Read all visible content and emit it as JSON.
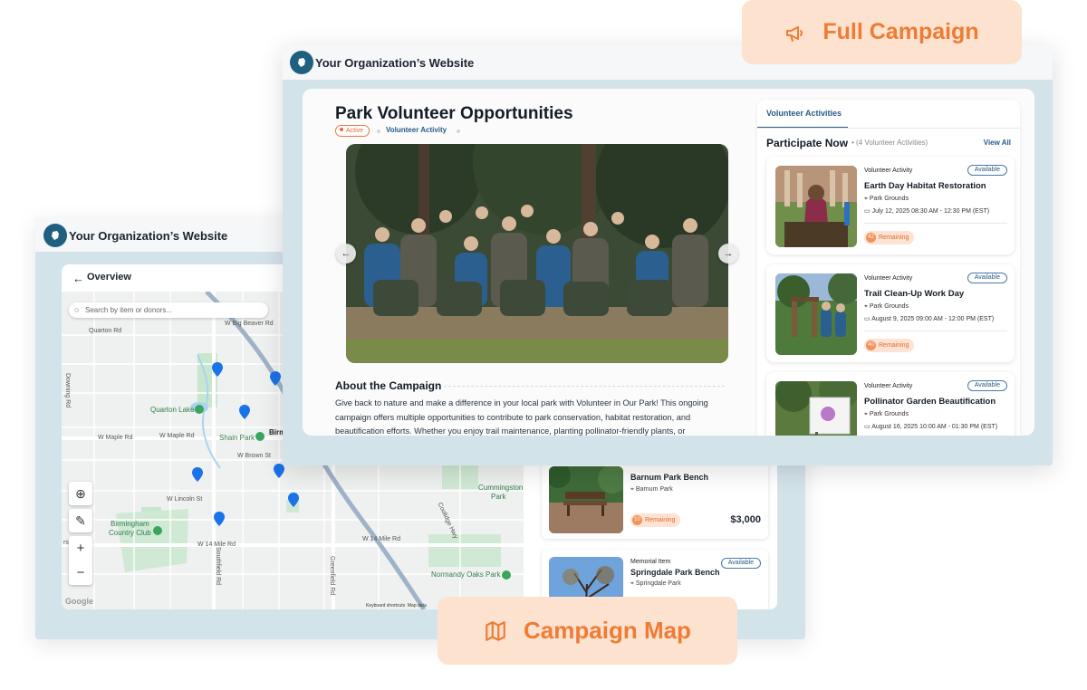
{
  "site_title": "Your Organization’s Website",
  "full_campaign_label": "Full Campaign",
  "campaign_map_label": "Campaign Map",
  "campaign": {
    "title": "Park Volunteer Opportunities",
    "status": "Active",
    "type": "Volunteer Activity",
    "about_title": "About the Campaign",
    "about_text": "Give back to nature and make a difference in your local park with Volunteer in Our Park! This ongoing campaign offers multiple opportunities to contribute to park conservation, habitat restoration, and beautification efforts. Whether you enjoy trail maintenance, planting pollinator-friendly plants, or"
  },
  "activities": {
    "tab": "Volunteer Activities",
    "heading": "Participate Now",
    "count": "(4 Volunteer Activities)",
    "view_all": "View All",
    "items": [
      {
        "type": "Volunteer Activity",
        "status": "Available",
        "title": "Earth Day Habitat Restoration",
        "location": "Park Grounds",
        "date": "July 12, 2025 08:30 AM - 12:30 PM (EST)",
        "remaining_count": "42",
        "remaining_label": "Remaining"
      },
      {
        "type": "Volunteer Activity",
        "status": "Available",
        "title": "Trail Clean-Up Work Day",
        "location": "Park Grounds",
        "date": "August 9, 2025 09:00 AM - 12:00 PM (EST)",
        "remaining_count": "40",
        "remaining_label": "Remaining"
      },
      {
        "type": "Volunteer Activity",
        "status": "Available",
        "title": "Pollinator Garden Beautification",
        "location": "Park Grounds",
        "date": "August 16, 2025 10:00 AM - 01:30 PM (EST)"
      }
    ]
  },
  "map_view": {
    "back_label": "Overview",
    "search_placeholder": "Search by item or donors...",
    "labels": {
      "quarton_rd": "Quarton Rd",
      "big_beaver": "W Big Beaver Rd",
      "quarton_lake": "Quarton Lake",
      "birm": "Birm",
      "maple_rd": "W Maple Rd",
      "maple_rd2": "W Maple Rd",
      "shain_park": "Shain Park",
      "brown_st": "W Brown St",
      "lincoln_st": "W Lincoln St",
      "cummingston": "Cummingston",
      "cummingston2": "Park",
      "birmingham_cc": "Birmingham",
      "birmingham_cc2": "Country Club",
      "w14_mile": "W 14 Mile Rd",
      "w14_mile2": "W 14 Mile Rd",
      "normandy": "Normandy Oaks Park",
      "downing": "Downing Rd",
      "southfield": "Southfield Rd",
      "greenfield": "Greenfield Rd",
      "coolidge": "Coolidge Hwy",
      "keyboard": "Keyboard shortcuts",
      "mapdata": "Map data",
      "google": "Google",
      "rs": "rs"
    },
    "items": [
      {
        "type": "",
        "status": "",
        "title": "Barnum Park Bench",
        "location": "Barnum Park",
        "remaining_count": "10",
        "remaining_label": "Remaining",
        "price": "$3,000"
      },
      {
        "type": "Memorial Item",
        "status": "Available",
        "title": "Springdale Park Bench",
        "location": "Springdale Park"
      }
    ]
  },
  "colors": {
    "accent_orange": "#ee7c35",
    "brand_blue": "#1f5f7f",
    "link_blue": "#2a5a8a",
    "pill_bg": "#fde2cf"
  },
  "icons": [
    "megaphone-icon",
    "map-icon",
    "logo-icon",
    "arrow-left-icon",
    "search-icon",
    "locate-icon",
    "draw-icon",
    "pin-icon",
    "calendar-icon"
  ]
}
